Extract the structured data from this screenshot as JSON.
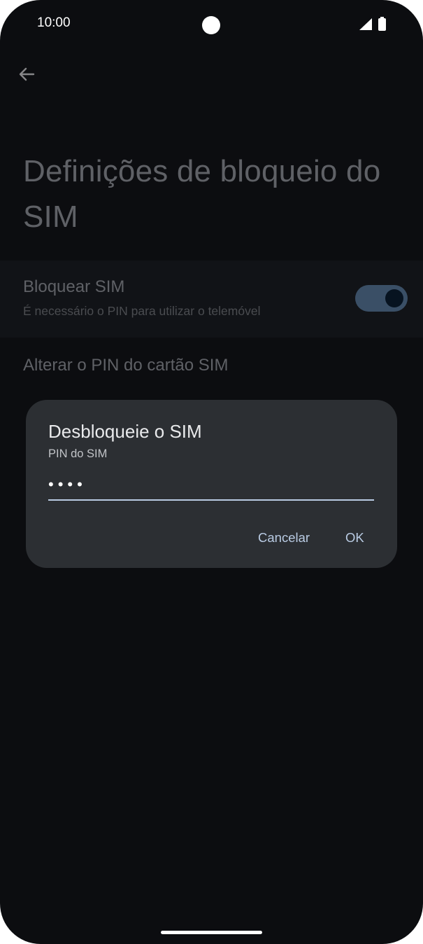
{
  "status_bar": {
    "time": "10:00",
    "icons": [
      "signal-icon",
      "battery-icon"
    ]
  },
  "header": {
    "back_icon": "back-arrow-icon",
    "title": "Definições de bloqueio do SIM"
  },
  "settings": {
    "lock_sim": {
      "title": "Bloquear SIM",
      "subtitle": "É necessário o PIN para utilizar o telemóvel",
      "enabled": true
    },
    "change_pin": {
      "title": "Alterar o PIN do cartão SIM"
    }
  },
  "dialog": {
    "title": "Desbloqueie o SIM",
    "label": "PIN do SIM",
    "pin_value": "••••",
    "cancel_label": "Cancelar",
    "ok_label": "OK"
  },
  "colors": {
    "background": "#0c0d10",
    "dialog": "#2c2f33",
    "accent": "#b9cbe3",
    "toggle_track": "#3a4f66"
  }
}
